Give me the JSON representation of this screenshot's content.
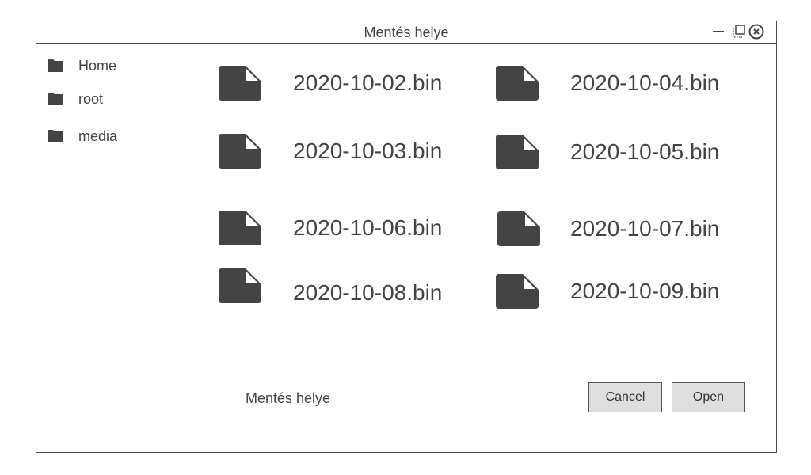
{
  "window": {
    "title": "Mentés helye"
  },
  "sidebar": {
    "items": [
      {
        "label": "Home",
        "icon": "folder-icon"
      },
      {
        "label": "root",
        "icon": "folder-icon"
      },
      {
        "label": "media",
        "icon": "folder-icon"
      }
    ]
  },
  "files": [
    {
      "name": "2020-10-02.bin",
      "icon": "file-icon"
    },
    {
      "name": "2020-10-04.bin",
      "icon": "file-icon"
    },
    {
      "name": "2020-10-03.bin",
      "icon": "file-icon"
    },
    {
      "name": "2020-10-05.bin",
      "icon": "file-icon"
    },
    {
      "name": "2020-10-06.bin",
      "icon": "file-icon"
    },
    {
      "name": "2020-10-07.bin",
      "icon": "file-icon"
    },
    {
      "name": "2020-10-08.bin",
      "icon": "file-icon"
    },
    {
      "name": "2020-10-09.bin",
      "icon": "file-icon"
    }
  ],
  "footer": {
    "location_label": "Mentés helye",
    "cancel_label": "Cancel",
    "open_label": "Open"
  },
  "colors": {
    "icon": "#444444",
    "border": "#4a4a4a",
    "button_bg": "#dedede"
  }
}
